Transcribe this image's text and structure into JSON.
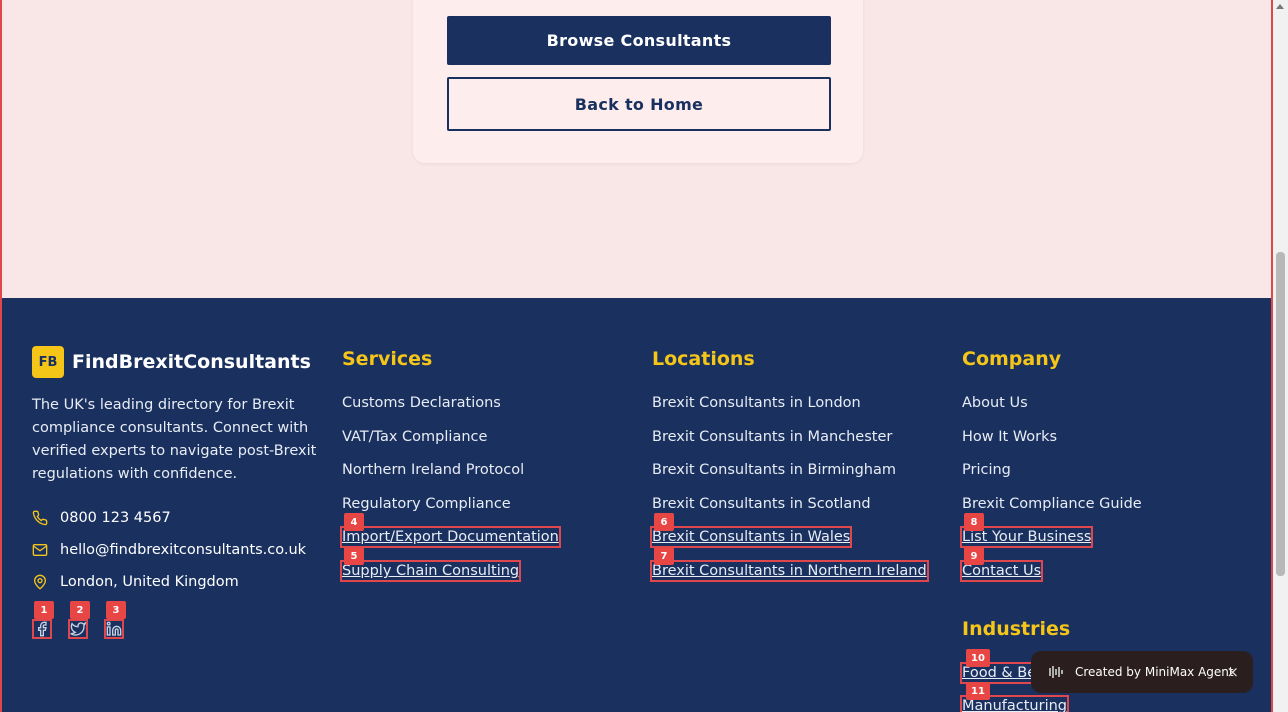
{
  "card": {
    "browse_label": "Browse Consultants",
    "back_label": "Back to Home"
  },
  "brand": {
    "logo": "FB",
    "name": "FindBrexitConsultants",
    "description": "The UK's leading directory for Brexit compliance consultants. Connect with verified experts to navigate post-Brexit regulations with confidence."
  },
  "contact": {
    "phone": "0800 123 4567",
    "email": "hello@findbrexitconsultants.co.uk",
    "location": "London, United Kingdom"
  },
  "social": [
    "facebook-icon",
    "twitter-icon",
    "linkedin-icon"
  ],
  "services": {
    "title": "Services",
    "links": [
      "Customs Declarations",
      "VAT/Tax Compliance",
      "Northern Ireland Protocol",
      "Regulatory Compliance",
      "Import/Export Documentation",
      "Supply Chain Consulting"
    ]
  },
  "locations": {
    "title": "Locations",
    "links": [
      "Brexit Consultants in London",
      "Brexit Consultants in Manchester",
      "Brexit Consultants in Birmingham",
      "Brexit Consultants in Scotland",
      "Brexit Consultants in Wales",
      "Brexit Consultants in Northern Ireland"
    ]
  },
  "company": {
    "title": "Company",
    "links": [
      "About Us",
      "How It Works",
      "Pricing",
      "Brexit Compliance Guide",
      "List Your Business",
      "Contact Us"
    ]
  },
  "industries": {
    "title": "Industries",
    "links": [
      "Food & Be",
      "Manufacturing"
    ]
  },
  "tags": [
    "1",
    "2",
    "3",
    "4",
    "5",
    "6",
    "7",
    "8",
    "9",
    "10",
    "11"
  ],
  "toast": {
    "text": "Created by MiniMax Agent",
    "close": "×"
  },
  "colors": {
    "navy": "#1a3160",
    "accent": "#f5c518",
    "highlight": "#e0474c",
    "page_bg": "#f9e6e6"
  }
}
